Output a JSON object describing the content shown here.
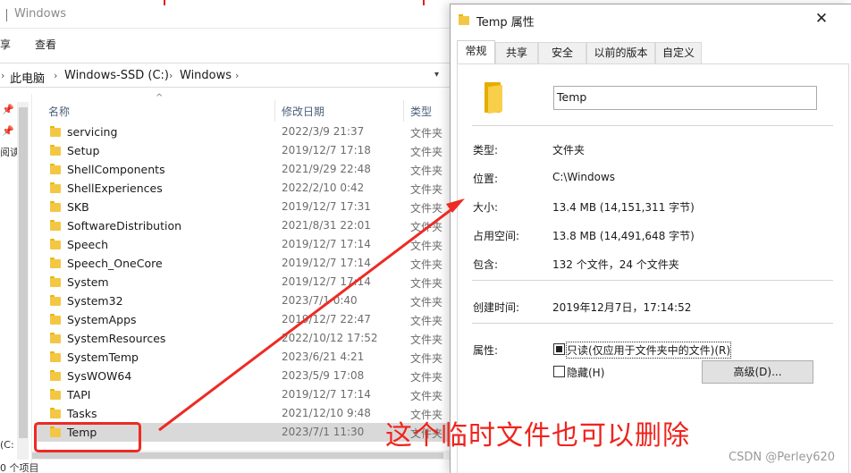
{
  "explorer": {
    "title": "Windows",
    "ribbon": {
      "share_label": "享",
      "view_label": "查看"
    },
    "address": {
      "crumbs": [
        "此电脑",
        "Windows-SSD (C:)",
        "Windows"
      ]
    },
    "nav_labels": {
      "reading": "阅读",
      "drive": "(C:",
      "status": "0 个项目"
    },
    "columns": {
      "name": "名称",
      "date": "修改日期",
      "type": "类型"
    },
    "files": [
      {
        "name": "servicing",
        "date": "2022/3/9 21:37",
        "type": "文件夹"
      },
      {
        "name": "Setup",
        "date": "2019/12/7 17:18",
        "type": "文件夹"
      },
      {
        "name": "ShellComponents",
        "date": "2021/9/29 22:48",
        "type": "文件夹"
      },
      {
        "name": "ShellExperiences",
        "date": "2022/2/10 0:42",
        "type": "文件夹"
      },
      {
        "name": "SKB",
        "date": "2019/12/7 17:31",
        "type": "文件夹"
      },
      {
        "name": "SoftwareDistribution",
        "date": "2021/8/31 22:01",
        "type": "文件夹"
      },
      {
        "name": "Speech",
        "date": "2019/12/7 17:14",
        "type": "文件夹"
      },
      {
        "name": "Speech_OneCore",
        "date": "2019/12/7 17:14",
        "type": "文件夹"
      },
      {
        "name": "System",
        "date": "2019/12/7 17:14",
        "type": "文件夹"
      },
      {
        "name": "System32",
        "date": "2023/7/1 0:40",
        "type": "文件夹"
      },
      {
        "name": "SystemApps",
        "date": "2019/12/7 22:47",
        "type": "文件夹"
      },
      {
        "name": "SystemResources",
        "date": "2022/10/12 17:52",
        "type": "文件夹"
      },
      {
        "name": "SystemTemp",
        "date": "2023/6/21 4:21",
        "type": "文件夹"
      },
      {
        "name": "SysWOW64",
        "date": "2023/5/9 17:08",
        "type": "文件夹"
      },
      {
        "name": "TAPI",
        "date": "2019/12/7 17:14",
        "type": "文件夹"
      },
      {
        "name": "Tasks",
        "date": "2021/12/10 9:48",
        "type": "文件夹"
      },
      {
        "name": "Temp",
        "date": "2023/7/1 11:30",
        "type": "文件夹",
        "selected": true
      }
    ]
  },
  "properties": {
    "title": "Temp 属性",
    "tabs": [
      "常规",
      "共享",
      "安全",
      "以前的版本",
      "自定义"
    ],
    "folder_name": "Temp",
    "fields": {
      "type_label": "类型:",
      "type_value": "文件夹",
      "location_label": "位置:",
      "location_value": "C:\\Windows",
      "size_label": "大小:",
      "size_value": "13.4 MB (14,151,311 字节)",
      "disk_label": "占用空间:",
      "disk_value": "13.8 MB (14,491,648 字节)",
      "contains_label": "包含:",
      "contains_value": "132 个文件，24 个文件夹",
      "created_label": "创建时间:",
      "created_value": "2019年12月7日，17:14:52",
      "attributes_label": "属性:"
    },
    "readonly_label": "只读(仅应用于文件夹中的文件)(R)",
    "hidden_label": "隐藏(H)",
    "advanced_label": "高级(D)..."
  },
  "annotation": {
    "text": "这个临时文件也可以删除",
    "watermark": "CSDN @Perley620",
    "color": "#ee2a24"
  },
  "colors": {
    "folder": "#f3c744",
    "selected_row": "#d9d9d9"
  }
}
